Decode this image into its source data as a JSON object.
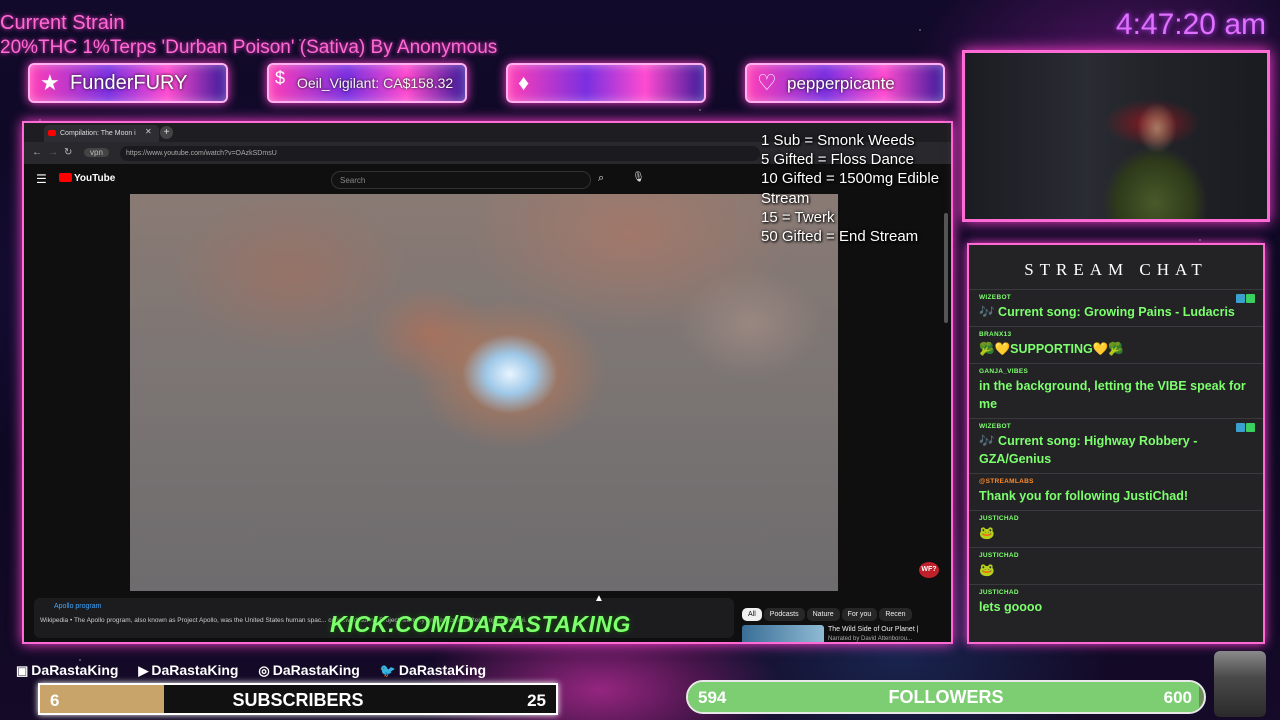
{
  "strain": {
    "title": "Current Strain",
    "description": "20%THC 1%Terps 'Durban Poison' (Sativa) By Anonymous"
  },
  "clock": "4:47:20 am",
  "badges": [
    {
      "icon": "star-icon",
      "text": "FunderFURY"
    },
    {
      "icon": "dollar-icon",
      "text": "Oeil_Vigilant: CA$158.32"
    },
    {
      "icon": "diamond-icon",
      "text": ""
    },
    {
      "icon": "heart-icon",
      "text": "pepperpicante"
    }
  ],
  "browser": {
    "tab_title": "Compilation: The Moon i",
    "url": "https://www.youtube.com/watch?v=OAzkSDmsU",
    "yt_logo": "YouTube",
    "search_placeholder": "Search",
    "wf_badge": "WF?",
    "description": {
      "link": "Apollo program",
      "text": "Wikipedia • The Apollo program, also known as Project Apollo, was the United States human spac... conceived during Project Mercury and executed after Project Gemini."
    },
    "chips": [
      "All",
      "Podcasts",
      "Nature",
      "For you",
      "Recen"
    ],
    "recommended": {
      "title": "The Wild Side of Our Planet |",
      "subtitle": "Narrated by David Attenborou..."
    }
  },
  "kick_url": "KICK.COM/DARASTAKING",
  "goals": [
    "1 Sub = Smonk Weeds",
    "5 Gifted = Floss Dance",
    "10 Gifted = 1500mg Edible",
    "Stream",
    "15 = Twerk",
    "50 Gifted = End Stream"
  ],
  "chat": {
    "title": "STREAM CHAT",
    "messages": [
      {
        "user": "WIZEBOT",
        "text": "🎶 Current song: Growing Pains - Ludacris",
        "badges": true
      },
      {
        "user": "BRANX13",
        "text": "🥦💛SUPPORTING💛🥦",
        "badges": false
      },
      {
        "user": "GANJA_VIBES",
        "text": "in the background, letting the VIBE speak for me",
        "badges": false
      },
      {
        "user": "WIZEBOT",
        "text": "🎶 Current song: Highway Robbery - GZA/Genius",
        "badges": true
      },
      {
        "user": "@STREAMLABS",
        "text": "Thank you for following JustiChad!",
        "badges": false
      },
      {
        "user": "JUSTICHAD",
        "text": "🐸",
        "badges": false
      },
      {
        "user": "JUSTICHAD",
        "text": "🐸",
        "badges": false
      },
      {
        "user": "JUSTICHAD",
        "text": "lets goooo",
        "badges": false
      }
    ]
  },
  "socials": [
    {
      "icon": "twitch-icon",
      "name": "DaRastaKing"
    },
    {
      "icon": "youtube-icon",
      "name": "DaRastaKing"
    },
    {
      "icon": "instagram-icon",
      "name": "DaRastaKing"
    },
    {
      "icon": "twitter-icon",
      "name": "DaRastaKing"
    }
  ],
  "subscribers": {
    "current": "6",
    "label": "SUBSCRIBERS",
    "goal": "25",
    "progress": 0.24
  },
  "followers": {
    "current": "594",
    "label": "FOLLOWERS",
    "goal": "600",
    "progress": 0.99
  }
}
